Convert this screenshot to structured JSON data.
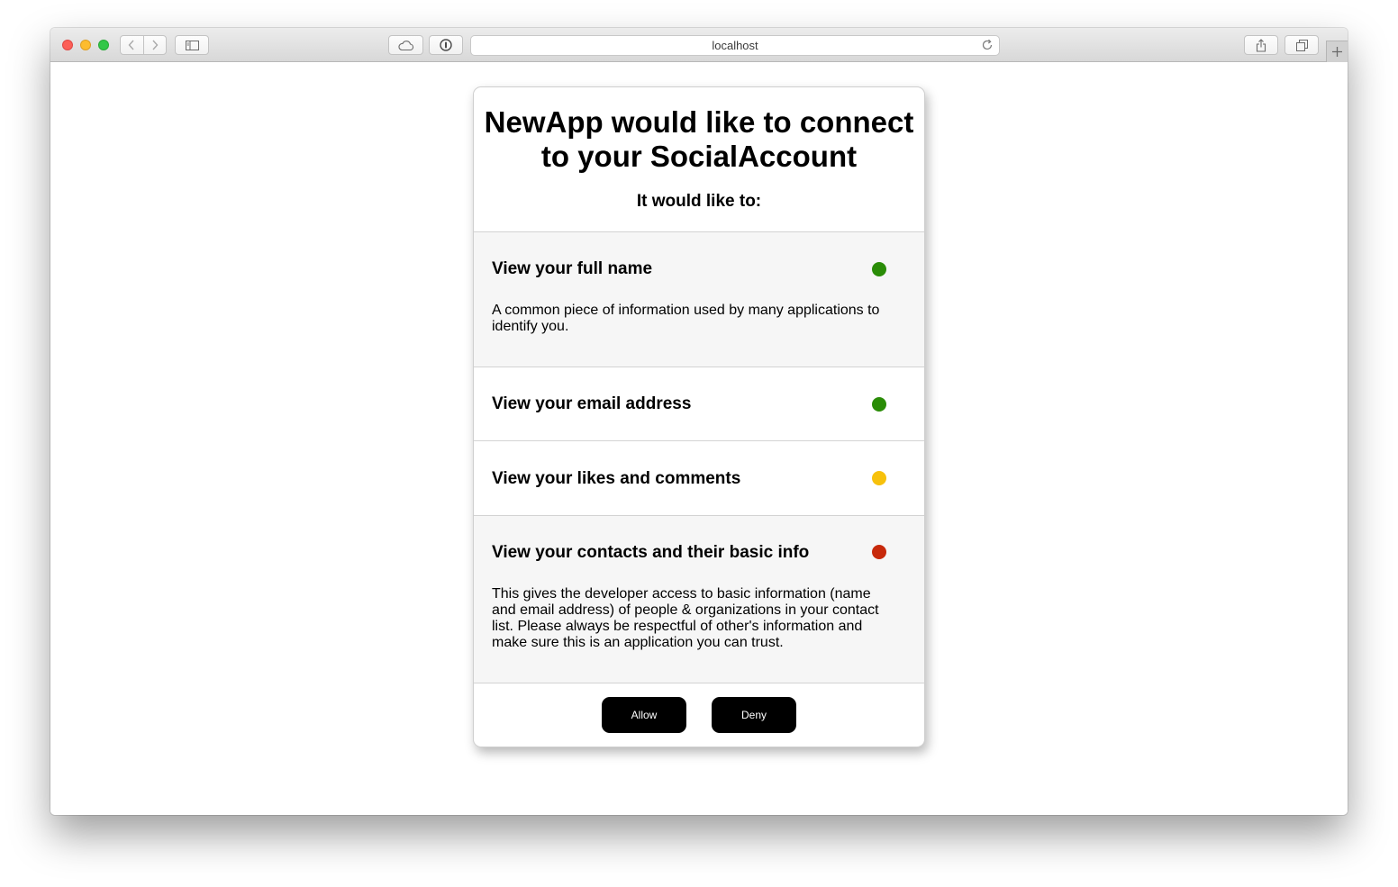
{
  "browser": {
    "address": "localhost",
    "icons": {
      "back": "chevron-left-icon",
      "forward": "chevron-right-icon",
      "sidebar": "sidebar-icon",
      "cloud": "cloud-icon",
      "password": "password-icon",
      "reload": "reload-icon",
      "share": "share-icon",
      "tabs": "tabs-overview-icon",
      "new_tab": "plus-icon"
    }
  },
  "dialog": {
    "title": "NewApp would like to connect to your SocialAccount",
    "subtitle": "It would like to:",
    "permissions": [
      {
        "title": "View your full name",
        "status_color": "#2a8c07",
        "description": "A common piece of information used by many applications to identify you."
      },
      {
        "title": "View your email address",
        "status_color": "#2a8c07",
        "description": ""
      },
      {
        "title": "View your likes and comments",
        "status_color": "#f7c10c",
        "description": ""
      },
      {
        "title": "View your contacts and their basic info",
        "status_color": "#c7290b",
        "description": "This gives the developer access to basic information (name and email address) of people & organizations in your contact list. Please always be respectful of other's information and make sure this is an application you can trust."
      }
    ],
    "allow_label": "Allow",
    "deny_label": "Deny"
  }
}
